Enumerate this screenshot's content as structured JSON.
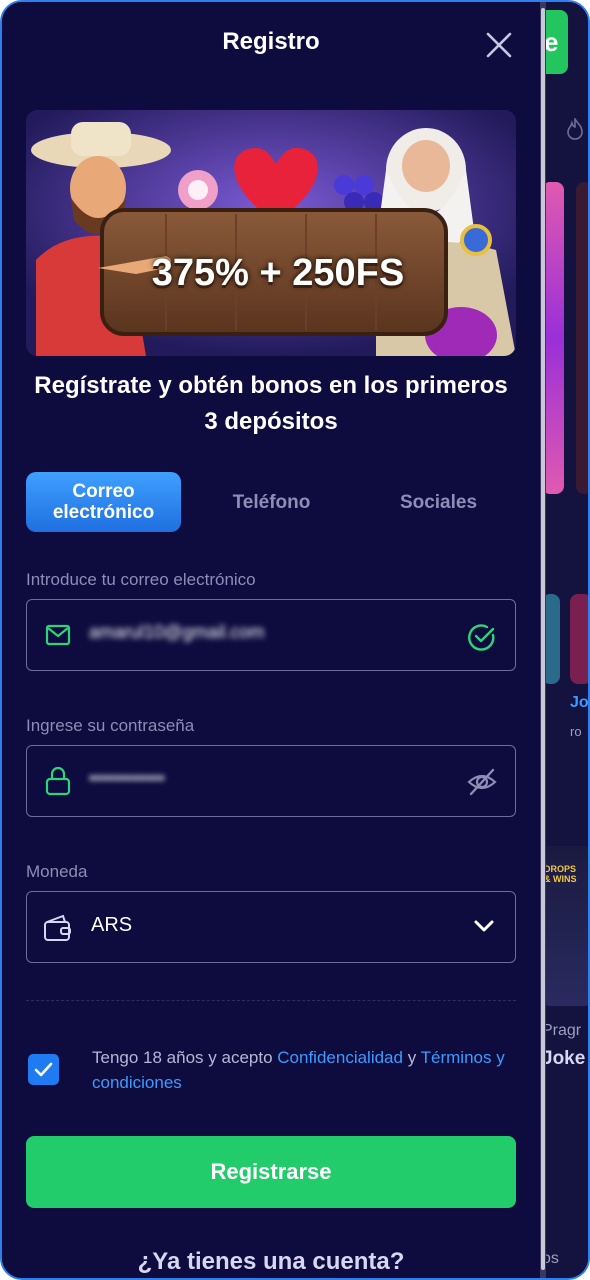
{
  "modal": {
    "title": "Registro",
    "banner_text": "375% + 250FS",
    "promo_headline": "Regístrate y obtén bonos en los primeros 3 depósitos"
  },
  "tabs": [
    {
      "label": "Correo electrónico",
      "active": true
    },
    {
      "label": "Teléfono",
      "active": false
    },
    {
      "label": "Sociales",
      "active": false
    }
  ],
  "email": {
    "label": "Introduce tu correo electrónico",
    "value": "amarul10@gmail.com",
    "status": "valid"
  },
  "password": {
    "label": "Ingrese su contraseña",
    "value": "••••••••••••"
  },
  "currency": {
    "label": "Moneda",
    "value": "ARS"
  },
  "consent": {
    "checked": true,
    "prefix": "Tengo 18 años y acepto",
    "privacy_link": "Confidencialidad",
    "conjunction": "y",
    "terms_link": "Términos y condiciones"
  },
  "register_button": "Registrarse",
  "have_account": "¿Ya tienes una cuenta?",
  "background": {
    "button_letter": "e",
    "provider_text": "Pragr",
    "game_text_1": "Jo",
    "game_text_2": "ro",
    "game_text_3": "Joke",
    "badge_text": "DROPS & WINS",
    "bottom_text": "os"
  },
  "colors": {
    "background": "#0e0b3f",
    "accent_blue": "#1e7bf2",
    "success_green": "#22cc6b",
    "link_blue": "#3d9bff"
  }
}
